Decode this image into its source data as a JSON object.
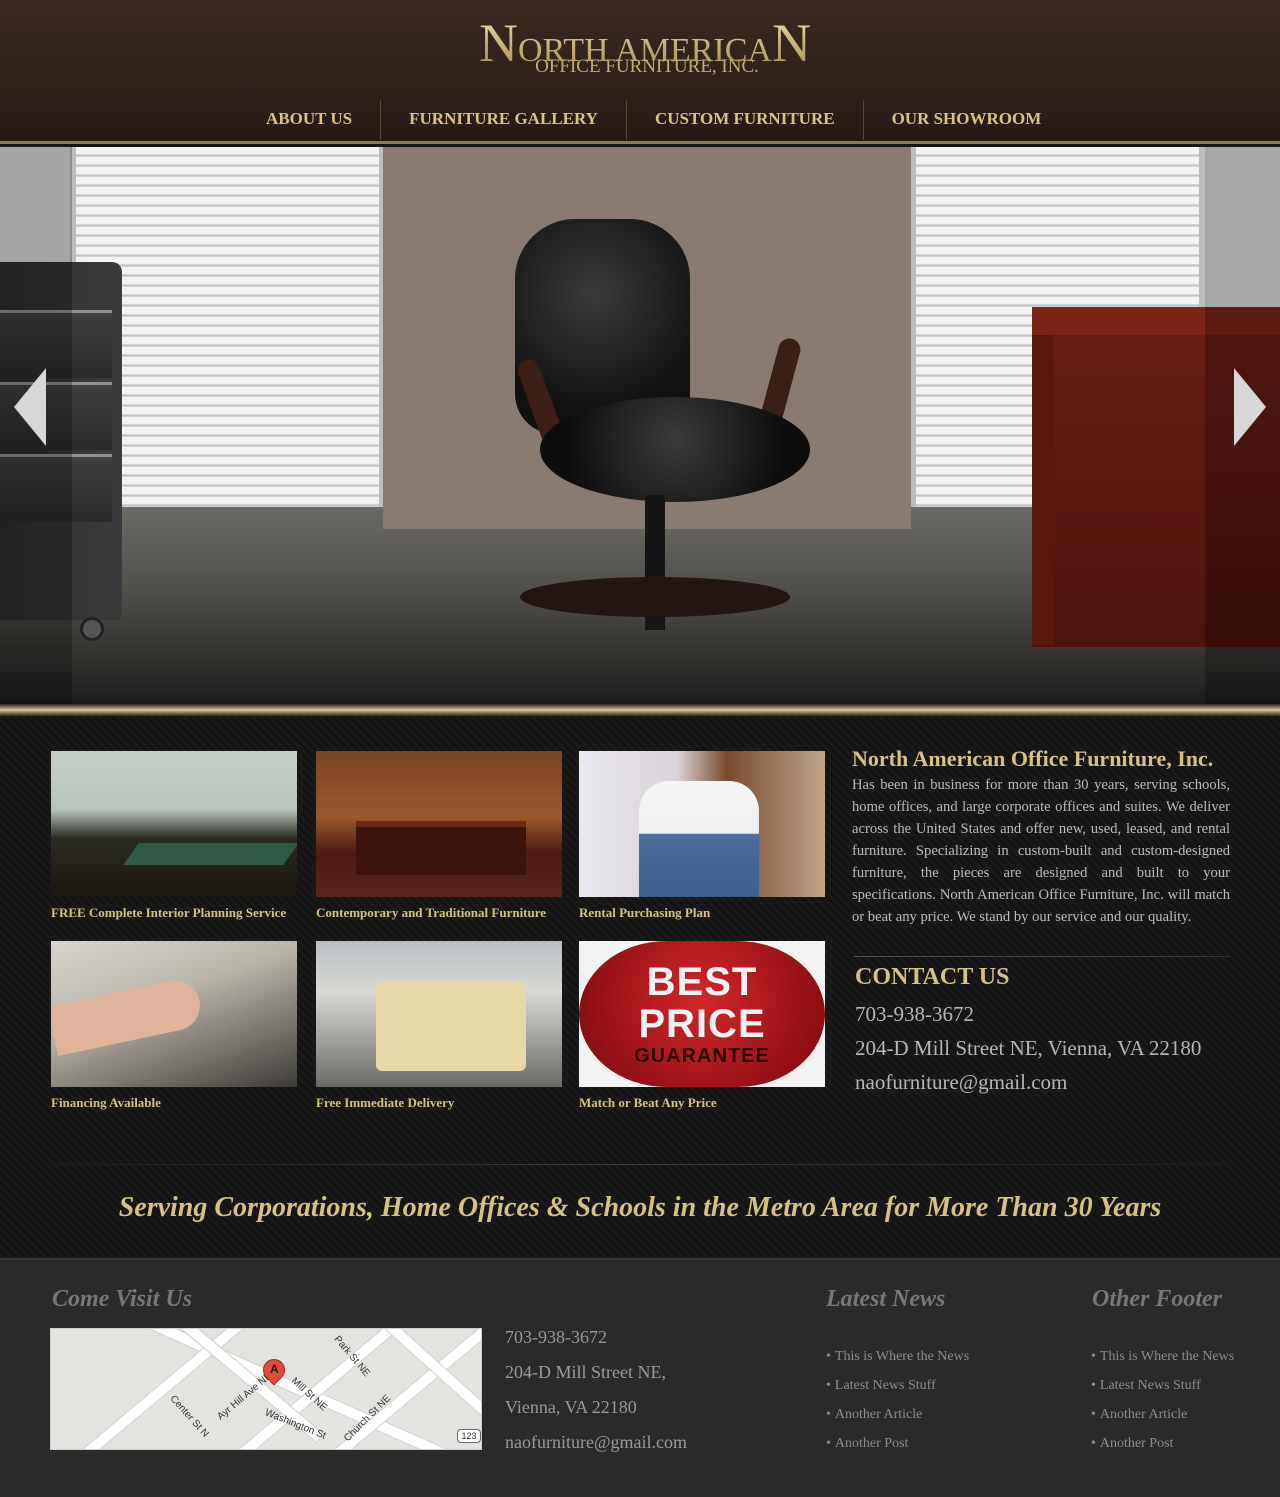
{
  "header": {
    "logo_top": "NORTH AMERICAN",
    "logo_bottom": "OFFICE FURNITURE, INC."
  },
  "nav": [
    {
      "label": "ABOUT US"
    },
    {
      "label": "FURNITURE GALLERY"
    },
    {
      "label": "CUSTOM FURNITURE"
    },
    {
      "label": "OUR SHOWROOM"
    }
  ],
  "features": [
    {
      "caption": "FREE Complete Interior Planning Service"
    },
    {
      "caption": "Contemporary and Traditional Furniture"
    },
    {
      "caption": "Rental Purchasing Plan"
    },
    {
      "caption": "Financing Available"
    },
    {
      "caption": "Free Immediate Delivery"
    },
    {
      "caption": "Match or Beat Any Price"
    }
  ],
  "badge": {
    "line1": "BEST",
    "line2": "PRICE",
    "line3": "GUARANTEE"
  },
  "about": {
    "title": "North American Office Furniture, Inc.",
    "body": "Has been in business for more than 30 years, serving schools, home offices, and large corporate offices and suites. We deliver across the United States and offer new, used, leased, and rental furniture. Specializing in custom-built and custom-designed furniture, the pieces are designed and built to your specifications. North American Office Furniture, Inc. will match or beat any price. We stand by our service and our quality."
  },
  "contact": {
    "title": "CONTACT US",
    "phone": "703-938-3672",
    "address": "204-D Mill Street NE, Vienna, VA 22180",
    "email": "naofurniture@gmail.com"
  },
  "tagline": "Serving Corporations, Home Offices & Schools in the Metro Area for More Than 30 Years",
  "footer": {
    "visit_title": "Come Visit Us",
    "phone": "703-938-3672",
    "address_line1": "204-D Mill Street NE,",
    "address_line2": "Vienna, VA 22180",
    "email": "naofurniture@gmail.com",
    "map": {
      "pin": "A",
      "route": "123",
      "streets": [
        "Park St NE",
        "Ayr Hill Ave NE",
        "Mill St NE",
        "Center St N",
        "Church St NE",
        "Washington St"
      ]
    },
    "news_title": "Latest News",
    "news": [
      "This is Where the News",
      "Latest News Stuff",
      "Another Article",
      "Another Post"
    ],
    "other_title": "Other Footer",
    "other": [
      "This is Where the News",
      "Latest News Stuff",
      "Another Article",
      "Another Post"
    ]
  }
}
